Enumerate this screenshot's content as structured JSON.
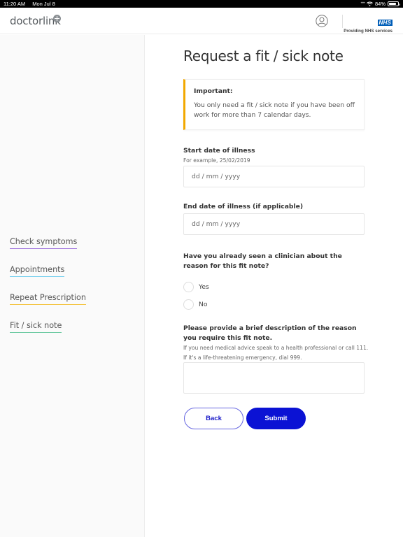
{
  "status_bar": {
    "time": "11:20 AM",
    "date": "Mon Jul 8",
    "battery_percent_label": "84%",
    "battery_level": 0.84,
    "icons": [
      "signal-dots-icon",
      "wifi-icon",
      "battery-icon"
    ]
  },
  "header": {
    "logo_text": "doctorlink",
    "account_icon": "user-circle-icon",
    "nhs_badge": "NHS",
    "nhs_caption": "Providing NHS services"
  },
  "sidebar": {
    "items": [
      {
        "label": "Check symptoms",
        "color": "#a77fe0"
      },
      {
        "label": "Appointments",
        "color": "#7fd3ef"
      },
      {
        "label": "Repeat Prescription",
        "color": "#f4c545"
      },
      {
        "label": "Fit / sick note",
        "color": "#6cc9a1"
      }
    ]
  },
  "main": {
    "title": "Request a fit / sick note",
    "alert": {
      "title": "Important:",
      "body": "You only need a fit / sick note if you have been off work for more than 7 calendar days.",
      "accent_color": "#f2a800"
    },
    "start_date": {
      "label": "Start date of illness",
      "hint": "For example, 25/02/2019",
      "placeholder": "dd / mm / yyyy",
      "value": ""
    },
    "end_date": {
      "label": "End date of illness (if applicable)",
      "placeholder": "dd / mm / yyyy",
      "value": ""
    },
    "clinician_question": {
      "label": "Have you already seen a clinician about the reason for this fit note?",
      "options": [
        "Yes",
        "No"
      ],
      "selected": null
    },
    "description": {
      "label": "Please provide a brief description of the reason you require this fit note.",
      "hint_line1": "If you need medical advice speak to a health professional or call 111.",
      "hint_line2": "If it's a life-threatening emergency, dial 999.",
      "value": ""
    },
    "buttons": {
      "back": "Back",
      "submit": "Submit",
      "primary_color": "#0b12d4"
    }
  }
}
